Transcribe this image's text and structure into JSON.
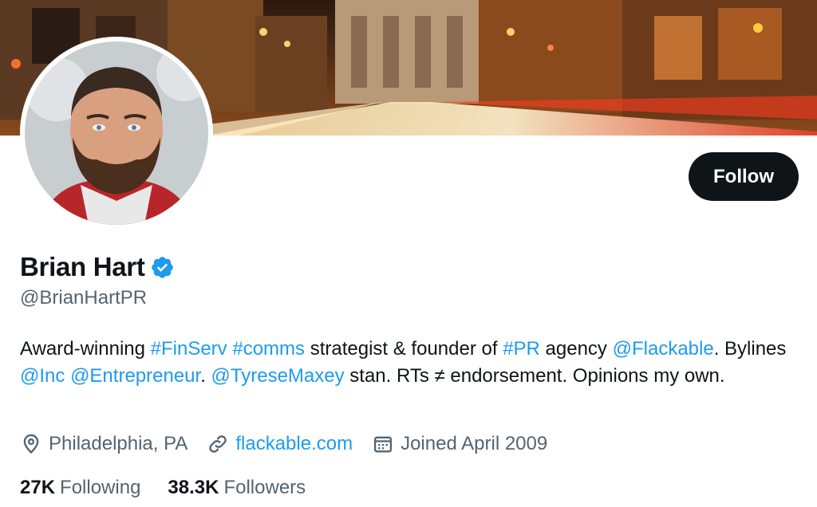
{
  "profile": {
    "display_name": "Brian Hart",
    "handle": "@BrianHartPR",
    "verified_icon": "verified-badge-icon",
    "follow_label": "Follow"
  },
  "bio": {
    "p1": "Award-winning ",
    "tag_finserv": "#FinServ",
    "p2": " ",
    "tag_comms": "#comms",
    "p3": " strategist & founder of ",
    "tag_pr": "#PR",
    "p4": " agency ",
    "mention_flackable": "@Flackable",
    "p5": ". Bylines ",
    "mention_inc": "@Inc",
    "p6": " ",
    "mention_entrepreneur": "@Entrepreneur",
    "p7": ". ",
    "mention_tyrese": "@TyreseMaxey",
    "p8": " stan. RTs ≠ endorsement. Opinions my own."
  },
  "meta": {
    "location": "Philadelphia, PA",
    "website": "flackable.com",
    "joined": "Joined April 2009"
  },
  "stats": {
    "following_count": "27K",
    "following_label": "Following",
    "followers_count": "38.3K",
    "followers_label": "Followers"
  },
  "colors": {
    "link": "#1d9bf0",
    "text": "#0f1419",
    "secondary": "#536471",
    "button": "#0f1419"
  }
}
